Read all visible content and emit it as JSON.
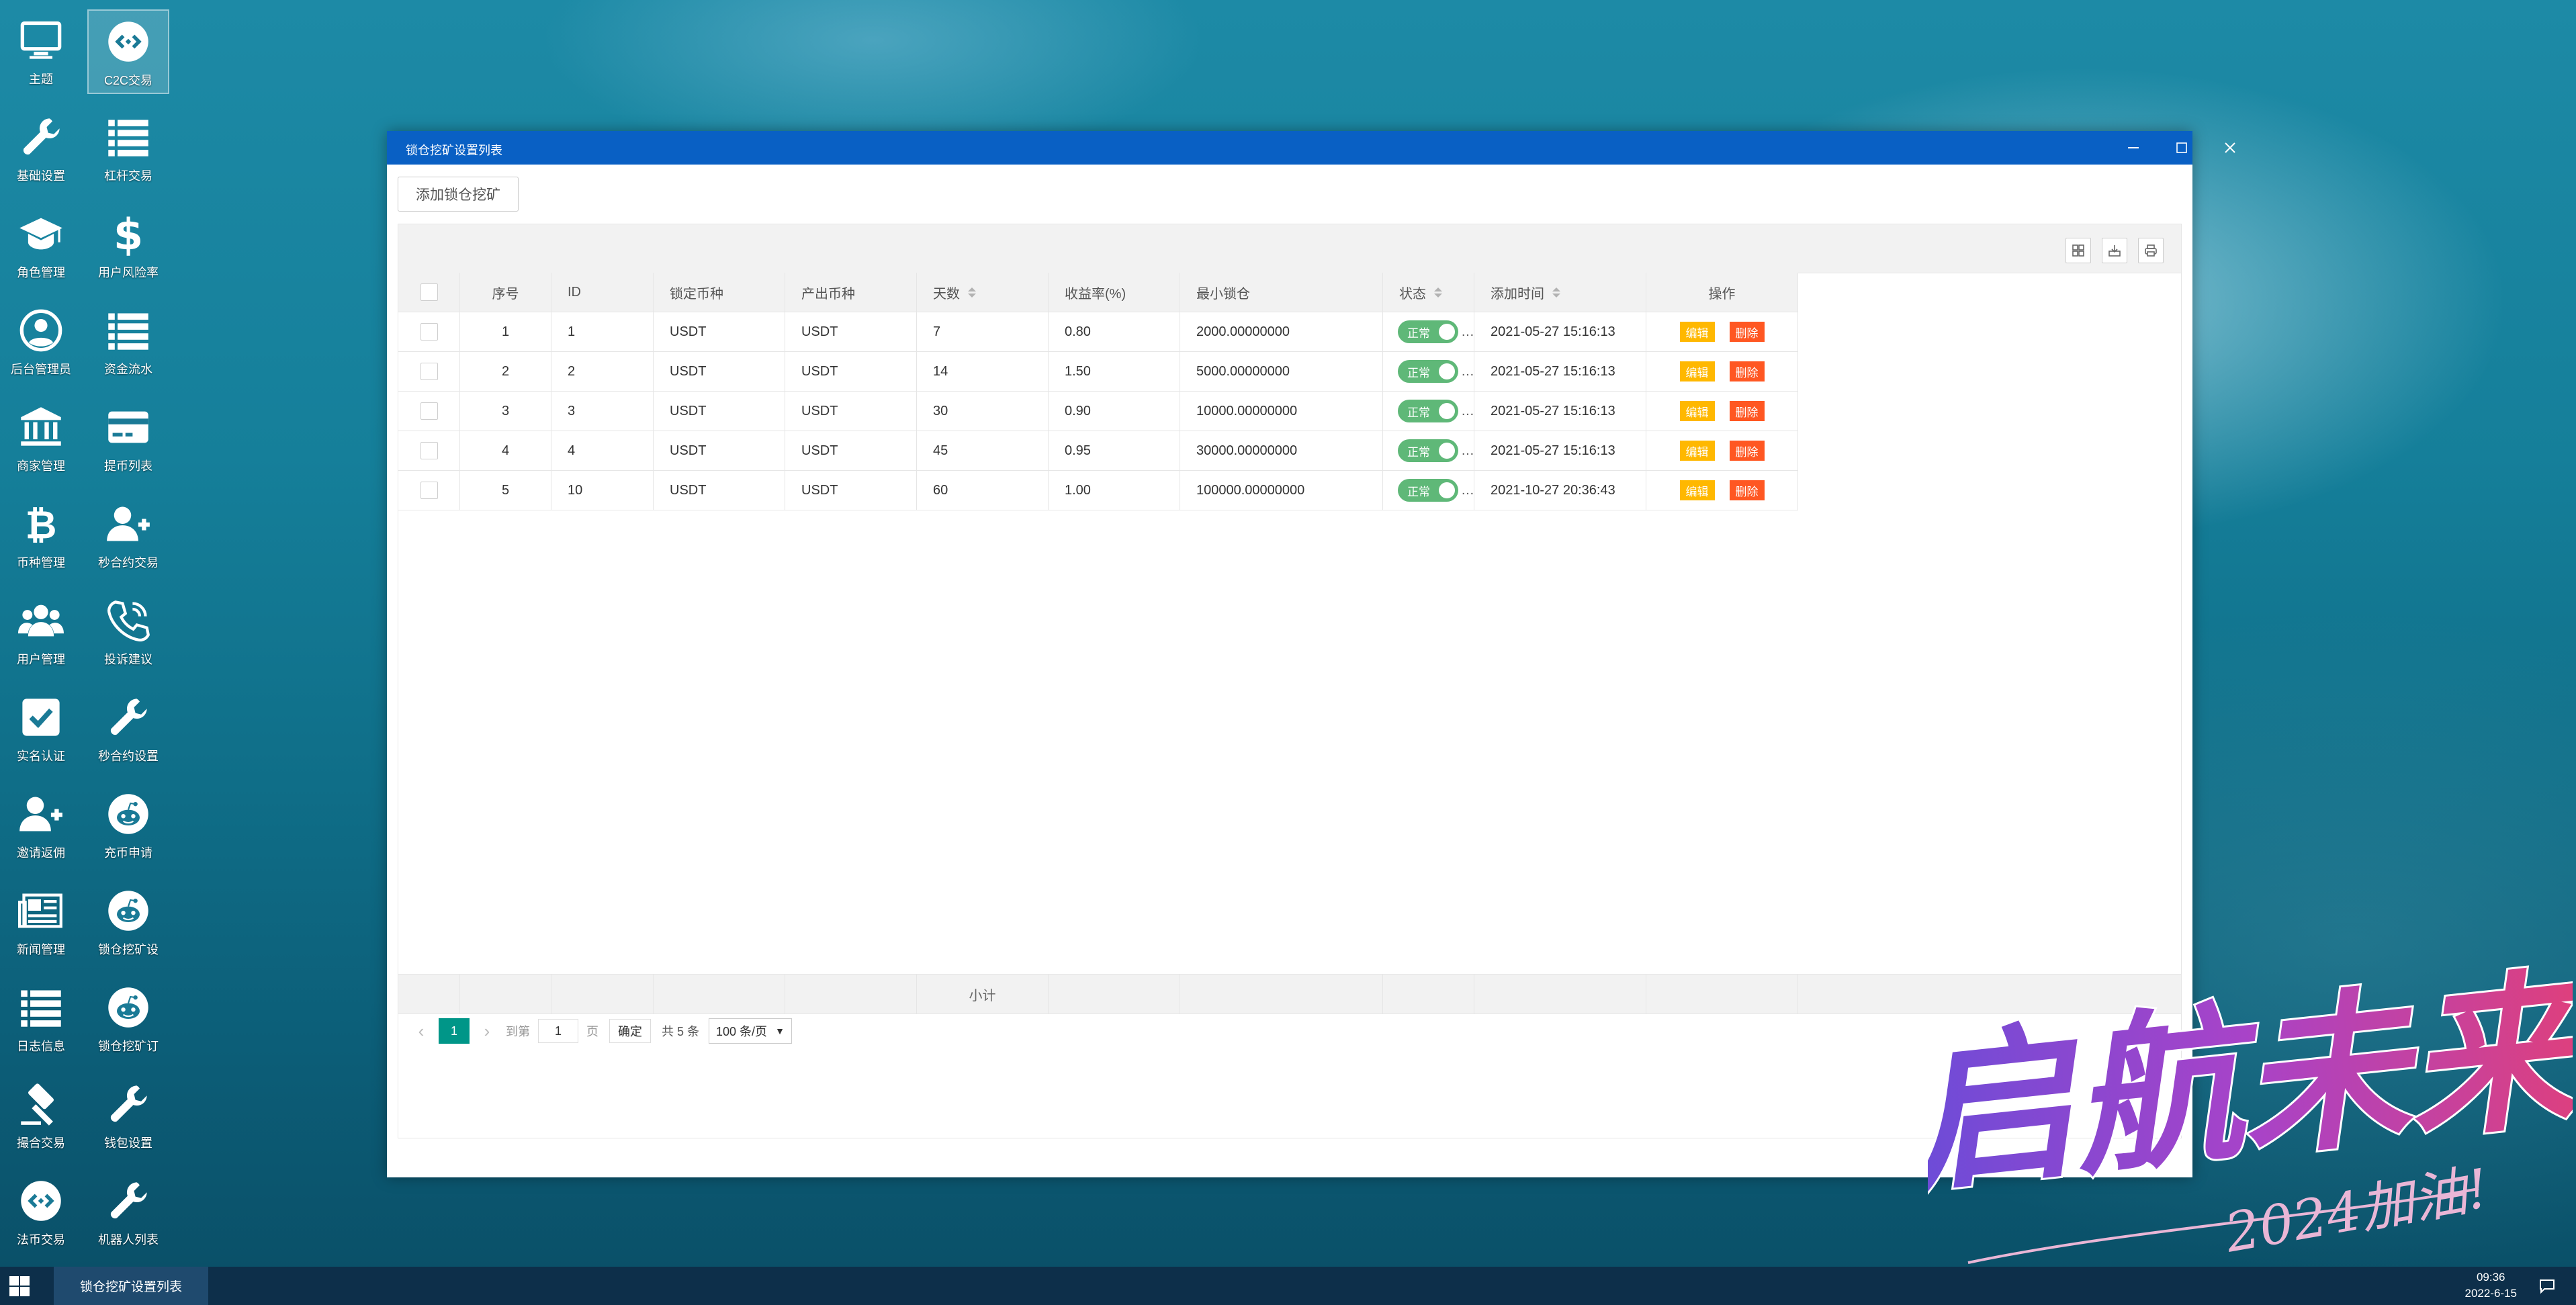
{
  "desktop": {
    "icons_col1": [
      {
        "label": "主题",
        "icon": "monitor-icon"
      },
      {
        "label": "基础设置",
        "icon": "wrench-icon"
      },
      {
        "label": "角色管理",
        "icon": "graduation-cap-icon"
      },
      {
        "label": "后台管理员",
        "icon": "user-circle-icon"
      },
      {
        "label": "商家管理",
        "icon": "bank-icon"
      },
      {
        "label": "币种管理",
        "icon": "bitcoin-icon"
      },
      {
        "label": "用户管理",
        "icon": "users-icon"
      },
      {
        "label": "实名认证",
        "icon": "check-square-icon"
      },
      {
        "label": "邀请返佣",
        "icon": "user-plus-icon"
      },
      {
        "label": "新闻管理",
        "icon": "newspaper-icon"
      },
      {
        "label": "日志信息",
        "icon": "list-icon"
      },
      {
        "label": "撮合交易",
        "icon": "gavel-icon"
      },
      {
        "label": "法币交易",
        "icon": "circle-link-icon"
      }
    ],
    "icons_col2": [
      {
        "label": "C2C交易",
        "icon": "circle-link-icon"
      },
      {
        "label": "杠杆交易",
        "icon": "list-icon"
      },
      {
        "label": "用户风险率",
        "icon": "dollar-icon"
      },
      {
        "label": "资金流水",
        "icon": "list-icon"
      },
      {
        "label": "提币列表",
        "icon": "credit-card-icon"
      },
      {
        "label": "秒合约交易",
        "icon": "user-plus-icon"
      },
      {
        "label": "投诉建议",
        "icon": "phone-icon"
      },
      {
        "label": "秒合约设置",
        "icon": "wrench-icon"
      },
      {
        "label": "充币申请",
        "icon": "reddit-icon"
      },
      {
        "label": "锁仓挖矿设",
        "icon": "reddit-icon"
      },
      {
        "label": "锁仓挖矿订",
        "icon": "reddit-icon"
      },
      {
        "label": "钱包设置",
        "icon": "wrench-icon"
      },
      {
        "label": "机器人列表",
        "icon": "wrench-icon"
      }
    ]
  },
  "window": {
    "title": "锁仓挖矿设置列表",
    "add_button": "添加锁仓挖矿",
    "columns": [
      "序号",
      "ID",
      "锁定币种",
      "产出币种",
      "天数",
      "收益率(%)",
      "最小锁仓",
      "状态",
      "添加时间",
      "操作"
    ],
    "rows": [
      {
        "seq": "1",
        "id": "1",
        "lock": "USDT",
        "out": "USDT",
        "days": "7",
        "rate": "0.80",
        "min": "2000.00000000",
        "status": "正常",
        "time": "2021-05-27 15:16:13"
      },
      {
        "seq": "2",
        "id": "2",
        "lock": "USDT",
        "out": "USDT",
        "days": "14",
        "rate": "1.50",
        "min": "5000.00000000",
        "status": "正常",
        "time": "2021-05-27 15:16:13"
      },
      {
        "seq": "3",
        "id": "3",
        "lock": "USDT",
        "out": "USDT",
        "days": "30",
        "rate": "0.90",
        "min": "10000.00000000",
        "status": "正常",
        "time": "2021-05-27 15:16:13"
      },
      {
        "seq": "4",
        "id": "4",
        "lock": "USDT",
        "out": "USDT",
        "days": "45",
        "rate": "0.95",
        "min": "30000.00000000",
        "status": "正常",
        "time": "2021-05-27 15:16:13"
      },
      {
        "seq": "5",
        "id": "10",
        "lock": "USDT",
        "out": "USDT",
        "days": "60",
        "rate": "1.00",
        "min": "100000.00000000",
        "status": "正常",
        "time": "2021-10-27 20:36:43"
      }
    ],
    "edit_label": "编辑",
    "delete_label": "删除",
    "subtotal_label": "小计",
    "pager": {
      "current": "1",
      "goto": "到第",
      "page_value": "1",
      "page_unit": "页",
      "confirm": "确定",
      "total": "共 5 条",
      "per_page": "100 条/页"
    }
  },
  "taskbar": {
    "task": "锁仓挖矿设置列表",
    "time": "09:36",
    "date": "2022-6-15"
  },
  "watermark": {
    "main": "启航未来",
    "sub": "2024加油!"
  },
  "colors": {
    "titlebar": "#0960c4",
    "switch_on": "#5fb878",
    "edit": "#ffb800",
    "delete": "#ff5722",
    "page_current": "#009688"
  }
}
